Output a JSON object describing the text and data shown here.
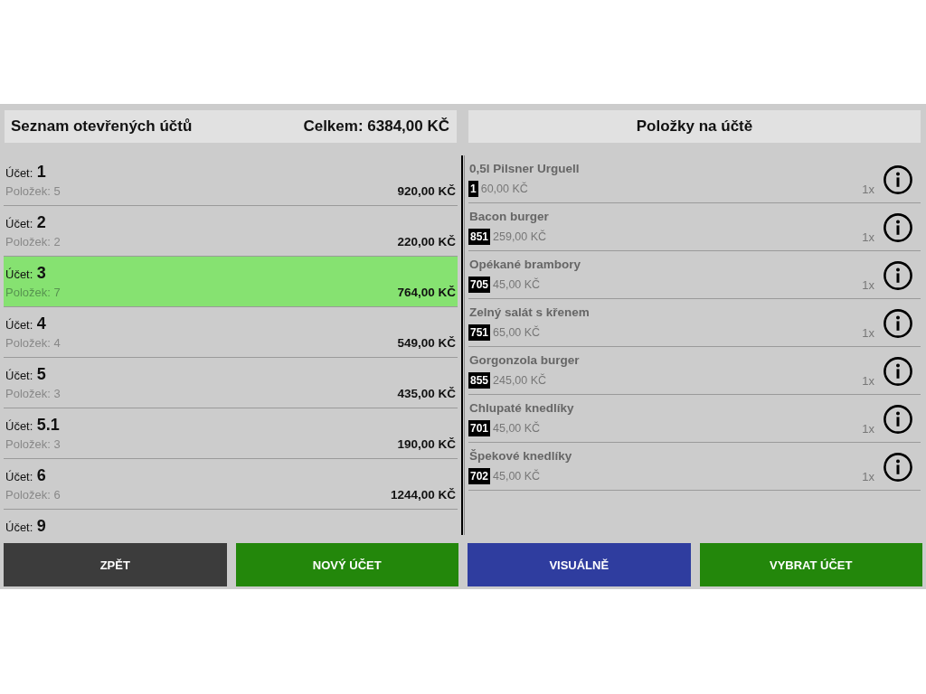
{
  "accounts_panel": {
    "title": "Seznam otevřených účtů",
    "total": "Celkem: 6384,00 KČ",
    "accounts": [
      {
        "label": "Účet:",
        "number": "1",
        "items": "Položek: 5",
        "amount": "920,00 KČ",
        "selected": false
      },
      {
        "label": "Účet:",
        "number": "2",
        "items": "Položek: 2",
        "amount": "220,00 KČ",
        "selected": false
      },
      {
        "label": "Účet:",
        "number": "3",
        "items": "Položek: 7",
        "amount": "764,00 KČ",
        "selected": true
      },
      {
        "label": "Účet:",
        "number": "4",
        "items": "Položek: 4",
        "amount": "549,00 KČ",
        "selected": false
      },
      {
        "label": "Účet:",
        "number": "5",
        "items": "Položek: 3",
        "amount": "435,00 KČ",
        "selected": false
      },
      {
        "label": "Účet:",
        "number": "5.1",
        "items": "Položek: 3",
        "amount": "190,00 KČ",
        "selected": false
      },
      {
        "label": "Účet:",
        "number": "6",
        "items": "Položek: 6",
        "amount": "1244,00 KČ",
        "selected": false
      },
      {
        "label": "Účet:",
        "number": "9",
        "selected": false
      }
    ]
  },
  "bill_items_panel": {
    "title": "Položky na účtě",
    "items": [
      {
        "name": "0,5l Pilsner Urguell",
        "code": "1",
        "price": "60,00 KČ",
        "quantity": "1x"
      },
      {
        "name": "Bacon burger",
        "code": "851",
        "price": "259,00 KČ",
        "quantity": "1x"
      },
      {
        "name": "Opékané brambory",
        "code": "705",
        "price": "45,00 KČ",
        "quantity": "1x"
      },
      {
        "name": "Zelný salát s křenem",
        "code": "751",
        "price": "65,00 KČ",
        "quantity": "1x"
      },
      {
        "name": "Gorgonzola burger",
        "code": "855",
        "price": "245,00 KČ",
        "quantity": "1x"
      },
      {
        "name": "Chlupaté knedlíky",
        "code": "701",
        "price": "45,00 KČ",
        "quantity": "1x"
      },
      {
        "name": "Špekové knedlíky",
        "code": "702",
        "price": "45,00 KČ",
        "quantity": "1x"
      }
    ]
  },
  "buttons": [
    {
      "label": "ZPĚT",
      "color": "#3c3c3c"
    },
    {
      "label": "NOVÝ ÚČET",
      "color": "#23870b"
    },
    {
      "label": "VISUÁLNĚ",
      "color": "#2f3d9f"
    },
    {
      "label": "VYBRAT ÚČET",
      "color": "#23870b"
    }
  ]
}
